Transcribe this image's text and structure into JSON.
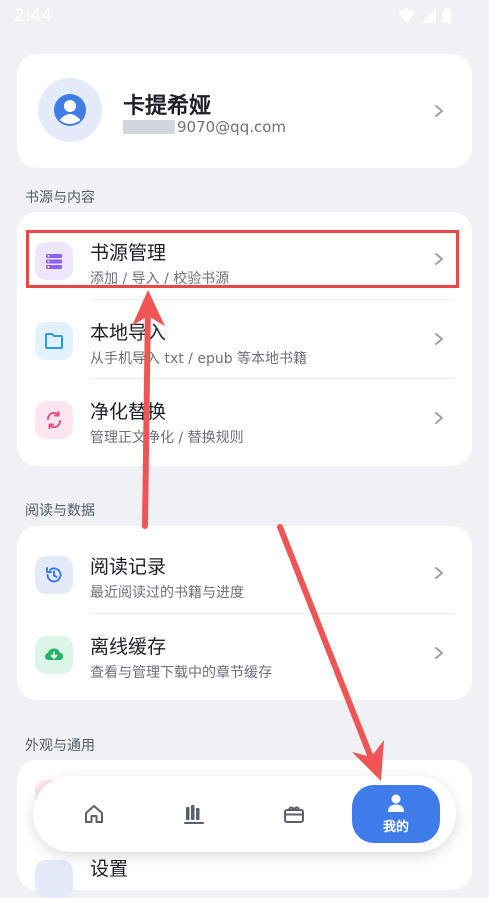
{
  "status_bar": {
    "time": "2:44"
  },
  "profile": {
    "name": "卡提希娅",
    "email": "9070@qq.com"
  },
  "sections": [
    {
      "title": "书源与内容",
      "items": [
        {
          "title": "书源管理",
          "subtitle": "添加 / 导入 / 校验书源",
          "icon": "list-icon"
        },
        {
          "title": "本地导入",
          "subtitle": "从手机导入 txt / epub 等本地书籍",
          "icon": "folder-icon"
        },
        {
          "title": "净化替换",
          "subtitle": "管理正文净化 / 替换规则",
          "icon": "refresh-search-icon"
        }
      ]
    },
    {
      "title": "阅读与数据",
      "items": [
        {
          "title": "阅读记录",
          "subtitle": "最近阅读过的书籍与进度",
          "icon": "history-icon"
        },
        {
          "title": "离线缓存",
          "subtitle": "查看与管理下载中的章节缓存",
          "icon": "cloud-download-icon"
        }
      ]
    },
    {
      "title": "外观与通用",
      "items": [
        {
          "title": "设置",
          "subtitle": "",
          "icon": "settings-icon"
        }
      ]
    }
  ],
  "tabbar": {
    "tabs": [
      {
        "name": "home",
        "label": ""
      },
      {
        "name": "bookshelf",
        "label": ""
      },
      {
        "name": "discover",
        "label": ""
      },
      {
        "name": "me",
        "label": "我的",
        "active": true
      }
    ]
  },
  "colors": {
    "accent": "#3f7ce9",
    "annotation": "#e84848",
    "background": "#eff1f5"
  }
}
